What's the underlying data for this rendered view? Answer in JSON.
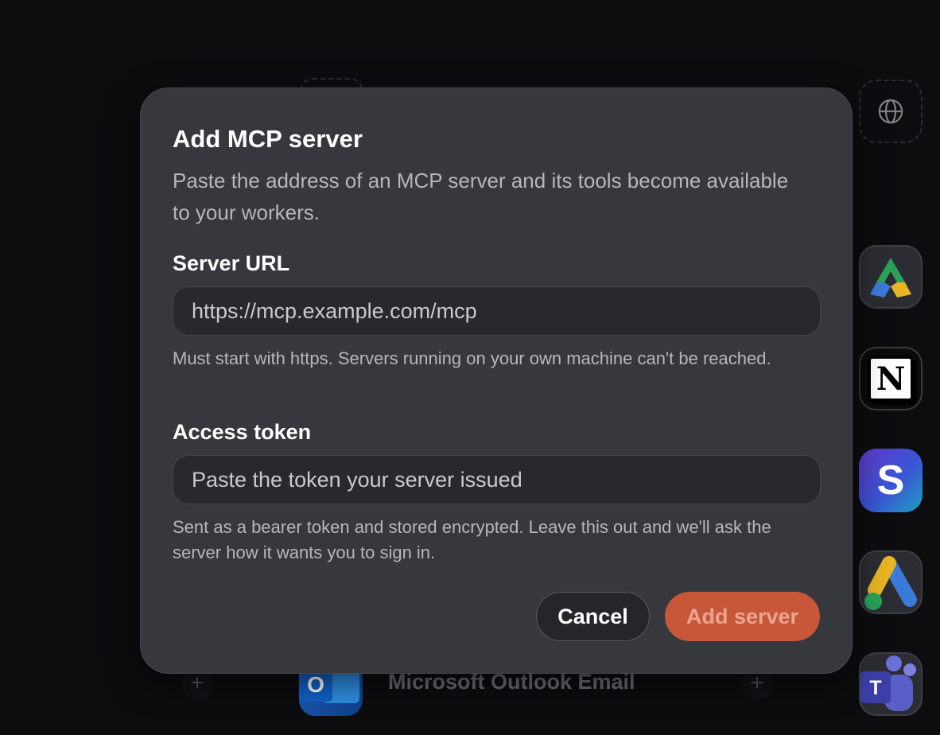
{
  "modal": {
    "title": "Add MCP server",
    "description": "Paste the address of an MCP server and its tools become available to your workers.",
    "server_url": {
      "label": "Server URL",
      "value": "",
      "placeholder": "https://mcp.example.com/mcp",
      "hint": "Must start with https. Servers running on your own machine can't be reached."
    },
    "access_token": {
      "label": "Access token",
      "value": "",
      "placeholder": "Paste the token your server issued",
      "hint": "Sent as a bearer token and stored encrypted. Leave this out and we'll ask the server how it wants you to sign in."
    },
    "cancel_label": "Cancel",
    "submit_label": "Add server"
  },
  "background": {
    "outlook_label": "Microsoft Outlook Email",
    "add_symbol": "+",
    "notion_letter": "N",
    "stacks_letter": "S",
    "outlook_letter": "O",
    "teams_letter": "T",
    "icons": [
      "globe-icon",
      "google-drive-icon",
      "notion-icon",
      "stacks-icon",
      "google-ads-icon",
      "microsoft-teams-icon",
      "microsoft-outlook-icon",
      "plus-icon"
    ]
  },
  "colors": {
    "backdrop": "#0d0d10",
    "modal_background": "#37383e",
    "input_background": "#28292e",
    "accent": "#c8573a",
    "accent_text": "#eaa590"
  }
}
